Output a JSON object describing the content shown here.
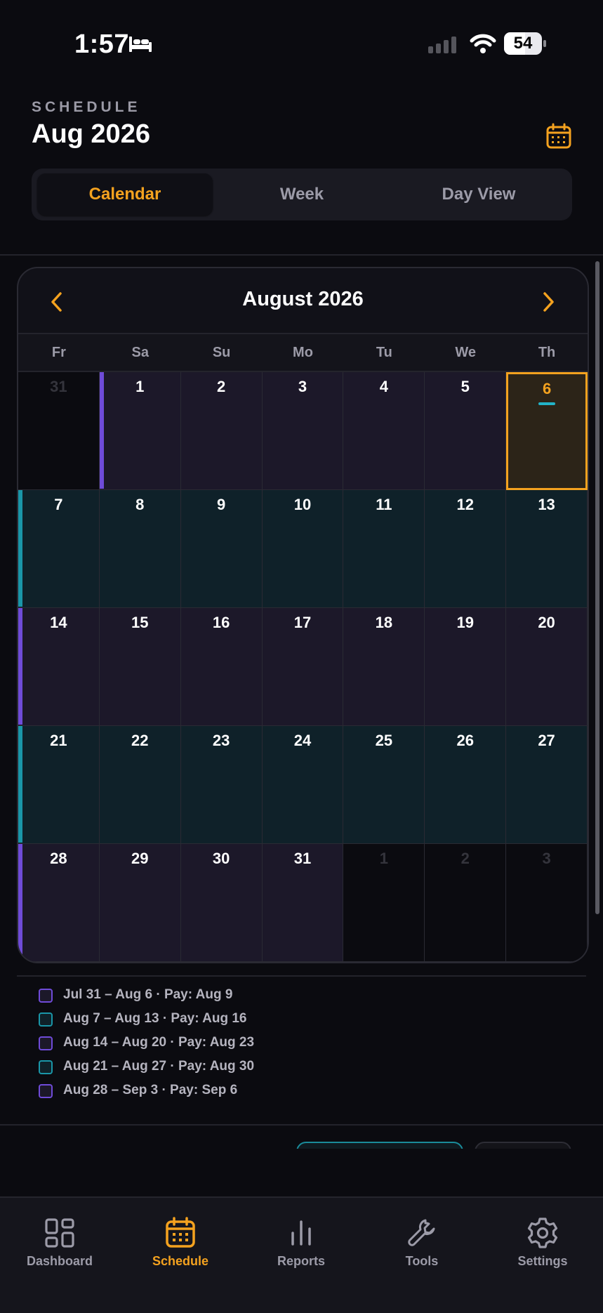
{
  "status": {
    "time": "1:57",
    "battery": "54"
  },
  "header": {
    "eyebrow": "SCHEDULE",
    "title": "Aug 2026"
  },
  "tabs": [
    {
      "label": "Calendar",
      "active": true
    },
    {
      "label": "Week",
      "active": false
    },
    {
      "label": "Day View",
      "active": false
    }
  ],
  "calendar": {
    "month_label": "August 2026",
    "weekdays": [
      "Fr",
      "Sa",
      "Su",
      "Mo",
      "Tu",
      "We",
      "Th"
    ],
    "weeks": [
      [
        {
          "day": "31",
          "out": true,
          "tint": "none"
        },
        {
          "day": "1",
          "tint": "purple"
        },
        {
          "day": "2",
          "tint": "purple"
        },
        {
          "day": "3",
          "tint": "purple"
        },
        {
          "day": "4",
          "tint": "purple"
        },
        {
          "day": "5",
          "tint": "purple"
        },
        {
          "day": "6",
          "tint": "purple",
          "today": true
        }
      ],
      [
        {
          "day": "7",
          "tint": "teal"
        },
        {
          "day": "8",
          "tint": "teal"
        },
        {
          "day": "9",
          "tint": "teal"
        },
        {
          "day": "10",
          "tint": "teal"
        },
        {
          "day": "11",
          "tint": "teal"
        },
        {
          "day": "12",
          "tint": "teal"
        },
        {
          "day": "13",
          "tint": "teal"
        }
      ],
      [
        {
          "day": "14",
          "tint": "purple"
        },
        {
          "day": "15",
          "tint": "purple"
        },
        {
          "day": "16",
          "tint": "purple"
        },
        {
          "day": "17",
          "tint": "purple"
        },
        {
          "day": "18",
          "tint": "purple"
        },
        {
          "day": "19",
          "tint": "purple"
        },
        {
          "day": "20",
          "tint": "purple"
        }
      ],
      [
        {
          "day": "21",
          "tint": "teal"
        },
        {
          "day": "22",
          "tint": "teal"
        },
        {
          "day": "23",
          "tint": "teal"
        },
        {
          "day": "24",
          "tint": "teal"
        },
        {
          "day": "25",
          "tint": "teal"
        },
        {
          "day": "26",
          "tint": "teal"
        },
        {
          "day": "27",
          "tint": "teal"
        }
      ],
      [
        {
          "day": "28",
          "tint": "purple"
        },
        {
          "day": "29",
          "tint": "purple"
        },
        {
          "day": "30",
          "tint": "purple"
        },
        {
          "day": "31",
          "tint": "purple"
        },
        {
          "day": "1",
          "out": true,
          "tint": "none"
        },
        {
          "day": "2",
          "out": true,
          "tint": "none"
        },
        {
          "day": "3",
          "out": true,
          "tint": "none"
        }
      ]
    ]
  },
  "legend": [
    {
      "text": "Jul 31 – Aug 6 · Pay: Aug 9",
      "tint": "purple"
    },
    {
      "text": "Aug 7 – Aug 13 · Pay: Aug 16",
      "tint": "teal"
    },
    {
      "text": "Aug 14 – Aug 20 · Pay: Aug 23",
      "tint": "purple"
    },
    {
      "text": "Aug 21 – Aug 27 · Pay: Aug 30",
      "tint": "teal"
    },
    {
      "text": "Aug 28 – Sep 3 · Pay: Sep 6",
      "tint": "purple"
    }
  ],
  "colors": {
    "accent": "#f4a21f",
    "purple_bg": "#1c1829",
    "teal_bg": "#0f2129",
    "purple_stripe": "#6f4bd8",
    "teal_stripe": "#1a96a8"
  },
  "bottom_nav": [
    {
      "label": "Dashboard",
      "icon": "dashboard-icon",
      "active": false
    },
    {
      "label": "Schedule",
      "icon": "calendar-icon",
      "active": true
    },
    {
      "label": "Reports",
      "icon": "bar-chart-icon",
      "active": false
    },
    {
      "label": "Tools",
      "icon": "wrench-icon",
      "active": false
    },
    {
      "label": "Settings",
      "icon": "gear-icon",
      "active": false
    }
  ]
}
